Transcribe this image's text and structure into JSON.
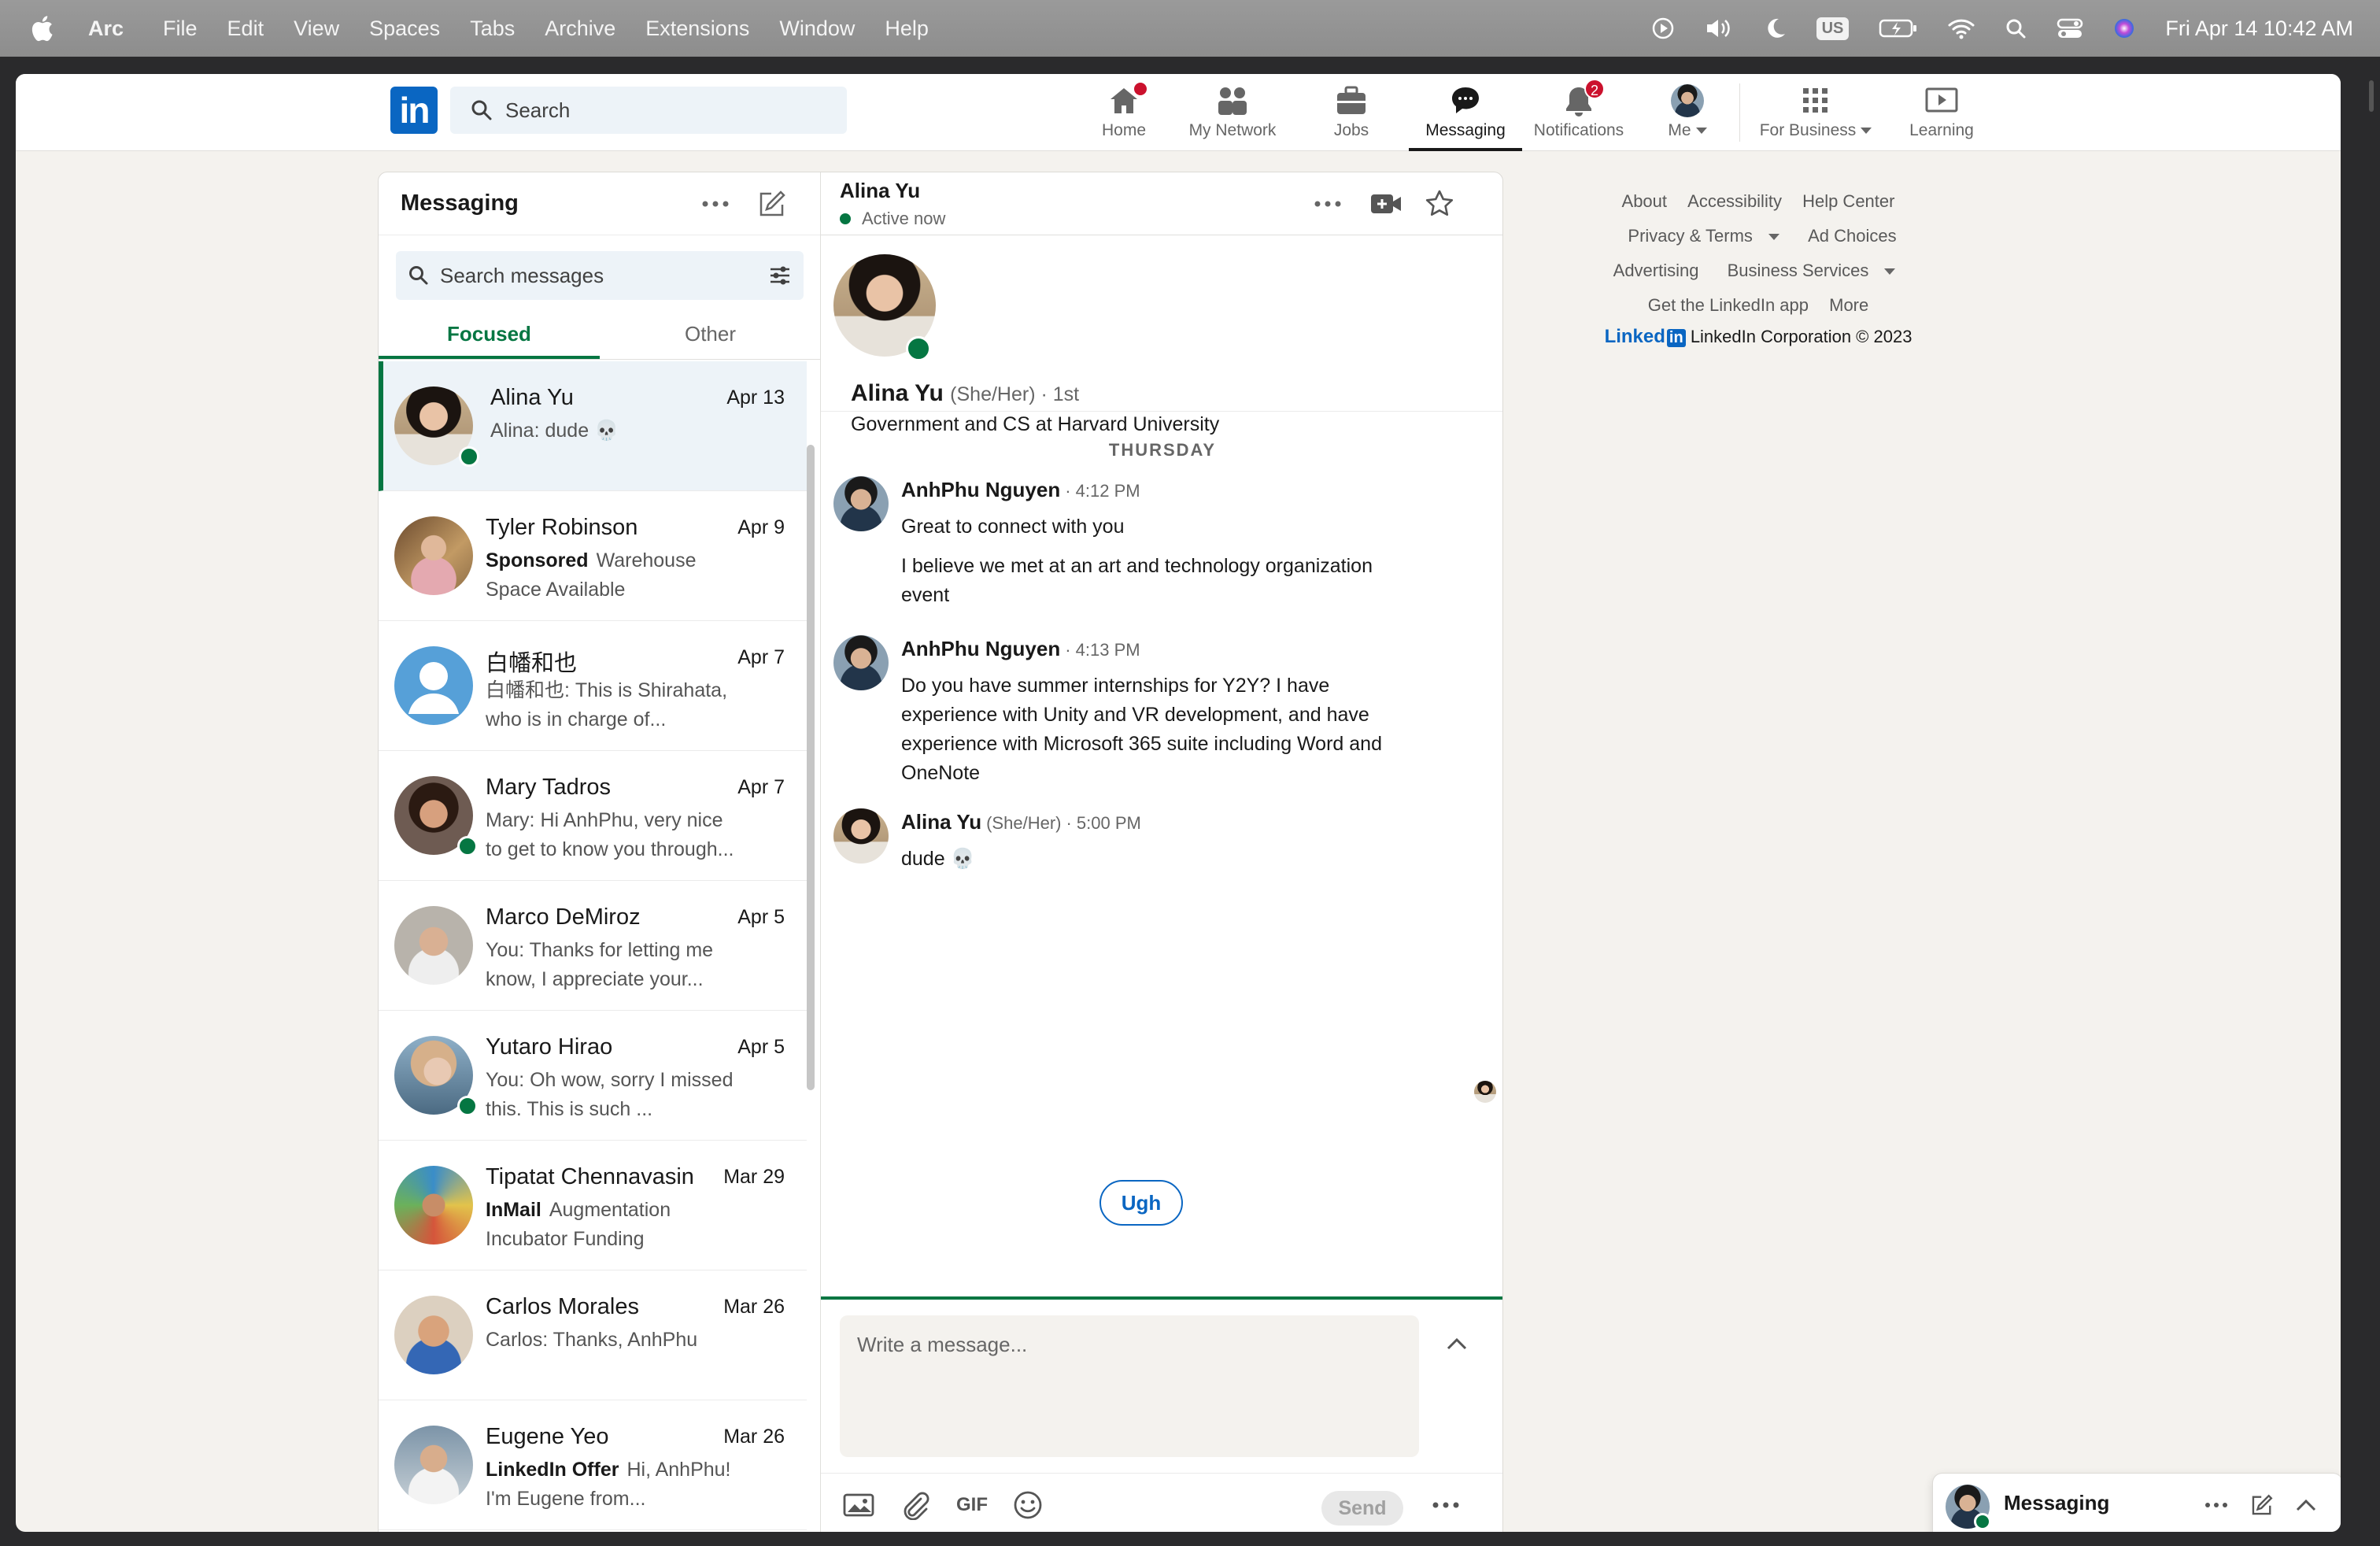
{
  "menubar": {
    "app": "Arc",
    "items": [
      "File",
      "Edit",
      "View",
      "Spaces",
      "Tabs",
      "Archive",
      "Extensions",
      "Window",
      "Help"
    ],
    "input_source": "US",
    "clock": "Fri Apr 14  10:42 AM"
  },
  "nav": {
    "search_placeholder": "Search",
    "items": [
      {
        "label": "Home",
        "icon": "home-icon"
      },
      {
        "label": "My Network",
        "icon": "network-icon"
      },
      {
        "label": "Jobs",
        "icon": "briefcase-icon"
      },
      {
        "label": "Messaging",
        "icon": "messaging-icon"
      },
      {
        "label": "Notifications",
        "icon": "bell-icon",
        "badge": "2"
      },
      {
        "label": "Me",
        "icon": "avatar"
      },
      {
        "label": "For Business",
        "icon": "grid-icon"
      },
      {
        "label": "Learning",
        "icon": "learning-icon"
      }
    ],
    "active": "Messaging"
  },
  "messaging": {
    "title": "Messaging",
    "search_placeholder": "Search messages",
    "tabs": [
      "Focused",
      "Other"
    ],
    "conversations": [
      {
        "name": "Alina Yu",
        "date": "Apr 13",
        "tag": "",
        "snippet": "Alina: dude 💀",
        "online": true
      },
      {
        "name": "Tyler Robinson",
        "date": "Apr 9",
        "tag": "Sponsored",
        "snippet": "Warehouse Space Available",
        "online": false
      },
      {
        "name": "白幡和也",
        "date": "Apr 7",
        "tag": "",
        "snippet": "白幡和也: This is Shirahata, who is in charge of...",
        "online": false
      },
      {
        "name": "Mary Tadros",
        "date": "Apr 7",
        "tag": "",
        "snippet": "Mary: Hi AnhPhu, very nice to get to know you through...",
        "online": true
      },
      {
        "name": "Marco DeMiroz",
        "date": "Apr 5",
        "tag": "",
        "snippet": "You: Thanks for letting me know, I appreciate your...",
        "online": false
      },
      {
        "name": "Yutaro Hirao",
        "date": "Apr 5",
        "tag": "",
        "snippet": "You: Oh wow, sorry I missed this. This is such ...",
        "online": true
      },
      {
        "name": "Tipatat Chennavasin",
        "date": "Mar 29",
        "tag": "InMail",
        "snippet": "Augmentation Incubator Funding",
        "online": false
      },
      {
        "name": "Carlos Morales",
        "date": "Mar 26",
        "tag": "",
        "snippet": "Carlos: Thanks, AnhPhu",
        "online": false
      },
      {
        "name": "Eugene Yeo",
        "date": "Mar 26",
        "tag": "LinkedIn Offer",
        "snippet": "Hi, AnhPhu! I'm Eugene from...",
        "online": false
      }
    ]
  },
  "thread": {
    "name": "Alina Yu",
    "status": "Active now",
    "profile": {
      "name": "Alina Yu",
      "pronouns": "(She/Her) · 1st",
      "headline": "Government and CS at Harvard University"
    },
    "day": "THURSDAY",
    "messages": [
      {
        "sender": "AnhPhu Nguyen",
        "pronouns": "",
        "time": "· 4:12 PM",
        "lines": [
          "Great to connect with you",
          "I believe we met at an art and technology organization event"
        ]
      },
      {
        "sender": "AnhPhu Nguyen",
        "pronouns": "",
        "time": "· 4:13 PM",
        "lines": [
          "Do you have summer internships for Y2Y? I have experience with Unity and VR development, and have experience with Microsoft 365 suite including Word and OneNote"
        ]
      },
      {
        "sender": "Alina Yu",
        "pronouns": "(She/Her)",
        "time": "· 5:00 PM",
        "lines": [
          "dude 💀"
        ]
      }
    ],
    "quick_reply": "Ugh",
    "composer_placeholder": "Write a message...",
    "send_label": "Send",
    "gif_label": "GIF"
  },
  "footer": {
    "rows": [
      [
        "About",
        "Accessibility",
        "Help Center"
      ],
      [
        "Privacy & Terms",
        "Ad Choices"
      ],
      [
        "Advertising",
        "Business Services"
      ],
      [
        "Get the LinkedIn app",
        "More"
      ]
    ],
    "brand": "Linked",
    "brand_box": "in",
    "copyright": "LinkedIn Corporation © 2023"
  },
  "overlay": {
    "title": "Messaging"
  },
  "colors": {
    "accent_green": "#057642",
    "brand_blue": "#0a66c2",
    "badge_red": "#cb112d"
  }
}
